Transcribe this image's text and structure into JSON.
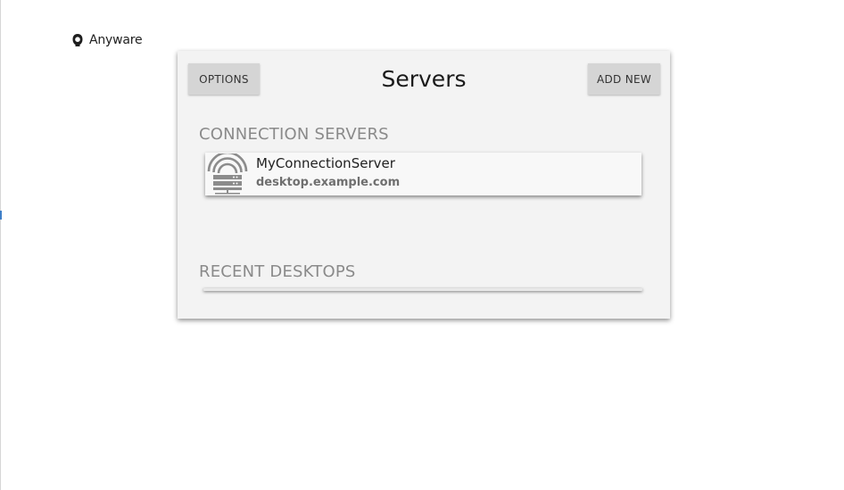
{
  "brand": {
    "name": "Anyware",
    "icon": "anyware-logo-icon"
  },
  "panel": {
    "title": "Servers",
    "options_label": "OPTIONS",
    "add_new_label": "ADD NEW"
  },
  "sections": {
    "connection_servers": {
      "title": "CONNECTION SERVERS",
      "items": [
        {
          "name": "MyConnectionServer",
          "host": "desktop.example.com",
          "icon": "connection-server-icon"
        }
      ]
    },
    "recent_desktops": {
      "title": "RECENT DESKTOPS",
      "items": []
    }
  },
  "colors": {
    "panel_bg": "#f3f3f3",
    "button_bg": "#d5d5d5",
    "section_title": "#8a8a8a",
    "accent_mark": "#3f7fc8"
  }
}
